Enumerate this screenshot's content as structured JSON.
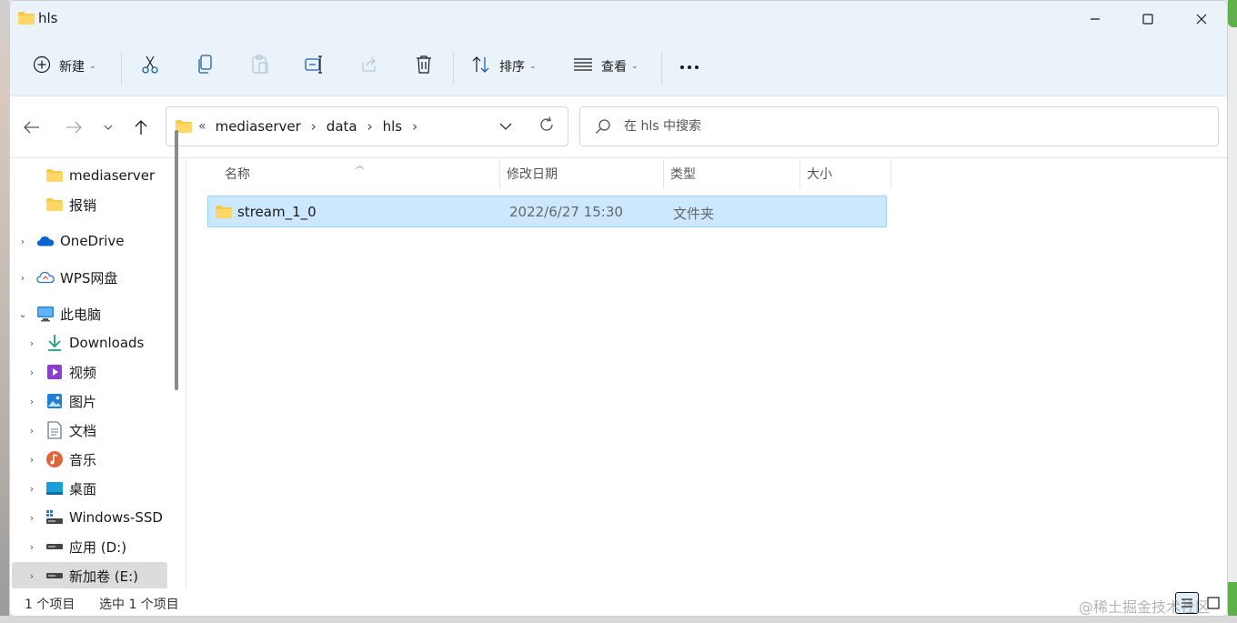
{
  "window": {
    "title": "hls"
  },
  "toolbar": {
    "new_label": "新建",
    "sort_label": "排序",
    "view_label": "查看"
  },
  "address": {
    "overflow": "«",
    "crumbs": [
      "mediaserver",
      "data",
      "hls"
    ]
  },
  "search": {
    "placeholder": "在 hls 中搜索"
  },
  "sidebar": {
    "items": [
      {
        "label": "mediaserver",
        "icon": "folder-icon"
      },
      {
        "label": "报销",
        "icon": "folder-icon"
      },
      {
        "label": "OneDrive",
        "icon": "onedrive-cloud-icon"
      },
      {
        "label": "WPS网盘",
        "icon": "wps-cloud-icon"
      },
      {
        "label": "此电脑",
        "icon": "this-pc-icon"
      },
      {
        "label": "Downloads",
        "icon": "download-arrow-icon"
      },
      {
        "label": "视频",
        "icon": "video-icon"
      },
      {
        "label": "图片",
        "icon": "pictures-icon"
      },
      {
        "label": "文档",
        "icon": "document-icon"
      },
      {
        "label": "音乐",
        "icon": "music-icon"
      },
      {
        "label": "桌面",
        "icon": "desktop-icon"
      },
      {
        "label": "Windows-SSD (",
        "icon": "windows-drive-icon"
      },
      {
        "label": "应用 (D:)",
        "icon": "drive-icon"
      },
      {
        "label": "新加卷 (E:)",
        "icon": "drive-icon"
      }
    ]
  },
  "columns": {
    "name": "名称",
    "modified": "修改日期",
    "type": "类型",
    "size": "大小"
  },
  "files": [
    {
      "name": "stream_1_0",
      "modified": "2022/6/27 15:30",
      "type": "文件夹",
      "size": ""
    }
  ],
  "status": {
    "count": "1 个项目",
    "selected": "选中 1 个项目"
  },
  "watermark": "@稀土掘金技术社区",
  "colors": {
    "accent": "#005fb8",
    "selection_bg": "#cce8ff",
    "folder": "#f8c94a"
  }
}
